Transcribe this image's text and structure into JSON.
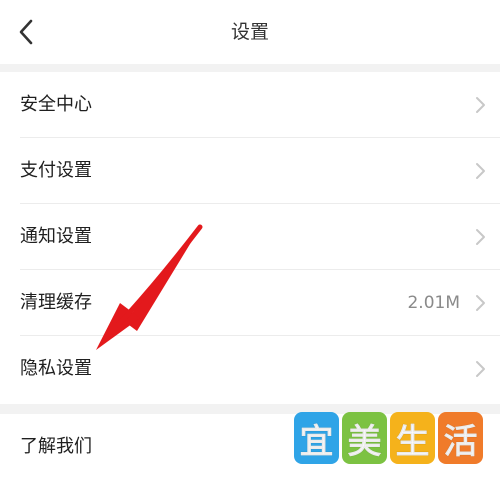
{
  "header": {
    "title": "设置",
    "back_icon": "chevron-left-icon"
  },
  "settings": {
    "items": [
      {
        "label": "安全中心",
        "value": ""
      },
      {
        "label": "支付设置",
        "value": ""
      },
      {
        "label": "通知设置",
        "value": ""
      },
      {
        "label": "清理缓存",
        "value": "2.01M"
      },
      {
        "label": "隐私设置",
        "value": ""
      }
    ],
    "about": {
      "label": "了解我们"
    }
  },
  "watermark": {
    "chars": [
      "宜",
      "美",
      "生",
      "活"
    ],
    "colors": [
      "#2fa4e7",
      "#7cc242",
      "#f5b21b",
      "#f07b2a"
    ]
  },
  "colors": {
    "annotation_arrow": "#e3191c",
    "chevron": "#c8c8c8",
    "background": "#f2f2f2"
  }
}
